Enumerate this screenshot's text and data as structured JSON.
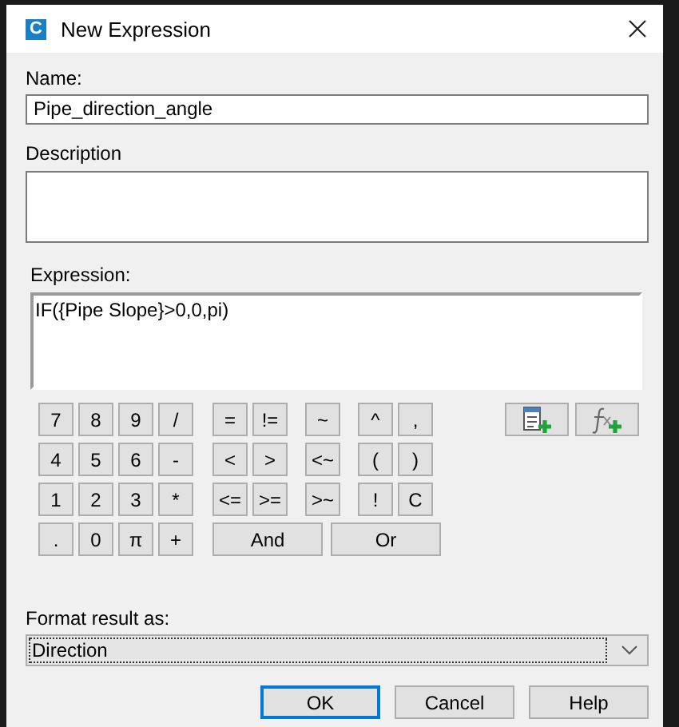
{
  "window": {
    "title": "New Expression",
    "logo": "C"
  },
  "name_field": {
    "label": "Name:",
    "value": "Pipe_direction_angle"
  },
  "description_field": {
    "label": "Description"
  },
  "expression_field": {
    "label": "Expression:",
    "value": "IF({Pipe Slope}>0,0,pi)"
  },
  "keypad": [
    [
      "7",
      "8",
      "9",
      "/",
      "=",
      "!=",
      "~",
      "^",
      ","
    ],
    [
      "4",
      "5",
      "6",
      "-",
      "<",
      ">",
      "<~",
      "(",
      ")"
    ],
    [
      "1",
      "2",
      "3",
      "*",
      "<=",
      ">=",
      ">~",
      "!",
      "C"
    ],
    [
      ".",
      "0",
      "π",
      "+",
      "And",
      "Or"
    ]
  ],
  "format": {
    "label": "Format result as:",
    "value": "Direction"
  },
  "buttons": [
    {
      "label": "OK",
      "selected": true
    },
    {
      "label": "Cancel",
      "selected": false
    },
    {
      "label": "Help",
      "selected": false
    }
  ]
}
